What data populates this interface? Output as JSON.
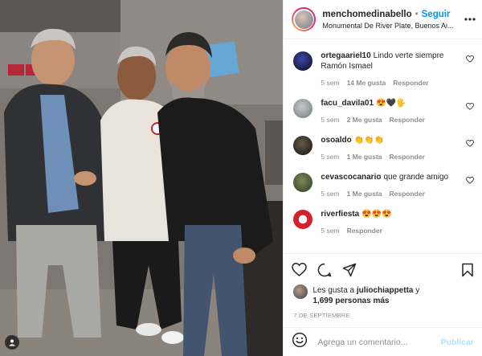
{
  "post": {
    "username": "menchomedinabello",
    "separator": "•",
    "follow_label": "Seguir",
    "location": "Monumental De River Plate, Buenos Ai..."
  },
  "comments": [
    {
      "username": "ortegaariel10",
      "text": "Lindo verte siempre Ramón Ismael",
      "time": "5 sem",
      "likes": "14 Me gusta",
      "reply": "Responder"
    },
    {
      "username": "facu_davila01",
      "text": "😍🖤🖐",
      "time": "5 sem",
      "likes": "2 Me gusta",
      "reply": "Responder"
    },
    {
      "username": "osoaldo",
      "text": "👏👏👏",
      "time": "5 sem",
      "likes": "1 Me gusta",
      "reply": "Responder"
    },
    {
      "username": "cevascocanario",
      "text": "que grande amigo",
      "time": "5 sem",
      "likes": "1 Me gusta",
      "reply": "Responder"
    },
    {
      "username": "riverfiesta",
      "text": "😍😍😍",
      "time": "5 sem",
      "likes": "",
      "reply": "Responder"
    }
  ],
  "likes_info": {
    "prefix": "Les gusta a",
    "user": "juliochiappetta",
    "conj": "y",
    "others": "1,699 personas más"
  },
  "date": "7 DE SEPTIEMBRE",
  "add_comment": {
    "placeholder": "Agrega un comentario...",
    "publish_label": "Publicar"
  },
  "icons": [
    "heart-icon",
    "comment-icon",
    "share-icon",
    "bookmark-icon",
    "emoji-icon",
    "more-icon"
  ],
  "colors": {
    "follow": "#0095f6",
    "publish_disabled": "#b2dffc",
    "meta": "#8e8e8e"
  }
}
